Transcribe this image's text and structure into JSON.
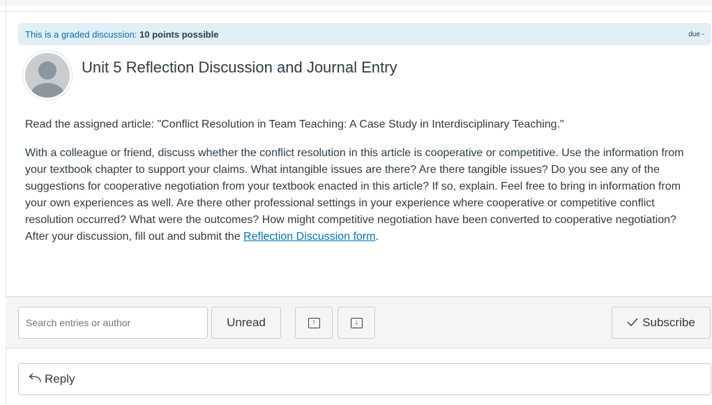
{
  "graded_banner": {
    "label": "This is a graded discussion:",
    "points": "10 points possible",
    "due": "due -"
  },
  "discussion": {
    "title": "Unit 5 Reflection Discussion and Journal Entry",
    "paragraph1": "Read the assigned article: \"Conflict Resolution in Team Teaching: A Case Study in Interdisciplinary Teaching.\"",
    "paragraph2": "With a colleague or friend, discuss whether the conflict resolution in this article is cooperative or competitive. Use the information from your textbook chapter to support your claims. What intangible issues are there? Are there tangible issues? Do you see any of the suggestions for cooperative negotiation from your textbook enacted in this article? If so, explain. Feel free to bring in information from your own experiences as well. Are there other professional settings in your experience where cooperative or competitive conflict resolution occurred? What were the outcomes? How might competitive negotiation have been converted to cooperative negotiation? After your discussion, fill out and submit the",
    "link_text": "Reflection Discussion form",
    "trailing": "."
  },
  "toolbar": {
    "search_placeholder": "Search entries or author",
    "unread_label": "Unread",
    "expand_icon": "arrow-up-icon",
    "collapse_icon": "arrow-down-icon",
    "subscribe_label": "Subscribe",
    "subscribe_icon": "checkmark-icon"
  },
  "reply": {
    "label": "Reply",
    "icon": "reply-arrow-icon"
  }
}
